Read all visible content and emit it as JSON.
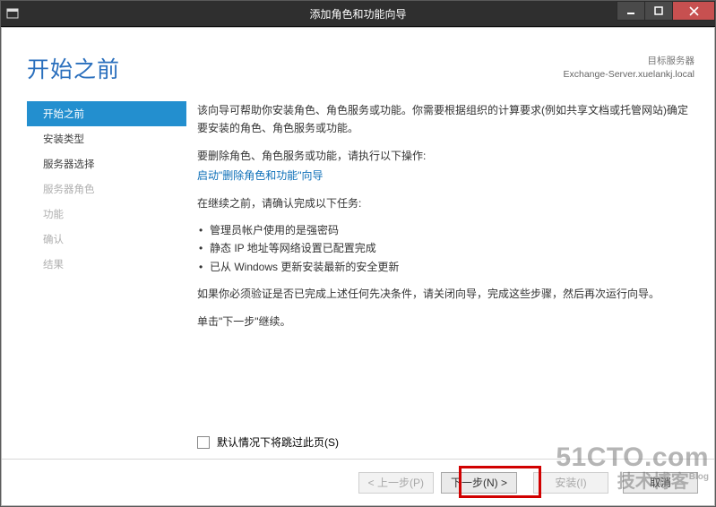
{
  "window": {
    "title": "添加角色和功能向导"
  },
  "header": {
    "page_title": "开始之前",
    "dest_label": "目标服务器",
    "dest_server": "Exchange-Server.xuelankj.local"
  },
  "sidebar": {
    "items": [
      {
        "label": "开始之前",
        "state": "active"
      },
      {
        "label": "安装类型",
        "state": "enabled"
      },
      {
        "label": "服务器选择",
        "state": "enabled"
      },
      {
        "label": "服务器角色",
        "state": "disabled"
      },
      {
        "label": "功能",
        "state": "disabled"
      },
      {
        "label": "确认",
        "state": "disabled"
      },
      {
        "label": "结果",
        "state": "disabled"
      }
    ]
  },
  "main": {
    "intro": "该向导可帮助你安装角色、角色服务或功能。你需要根据组织的计算要求(例如共享文档或托管网站)确定要安装的角色、角色服务或功能。",
    "remove_intro": "要删除角色、角色服务或功能，请执行以下操作:",
    "remove_link": "启动\"删除角色和功能\"向导",
    "confirm_intro": "在继续之前，请确认完成以下任务:",
    "bullets": [
      "管理员帐户使用的是强密码",
      "静态 IP 地址等网络设置已配置完成",
      "已从 Windows 更新安装最新的安全更新"
    ],
    "validate_note": "如果你必须验证是否已完成上述任何先决条件，请关闭向导，完成这些步骤，然后再次运行向导。",
    "continue_note": "单击\"下一步\"继续。",
    "skip_checkbox": "默认情况下将跳过此页(S)"
  },
  "footer": {
    "prev": "< 上一步(P)",
    "next": "下一步(N) >",
    "install": "安装(I)",
    "cancel": "取消"
  },
  "watermark": {
    "line1": "51CTO.com",
    "line2": "技术博客",
    "blog": "Blog"
  }
}
